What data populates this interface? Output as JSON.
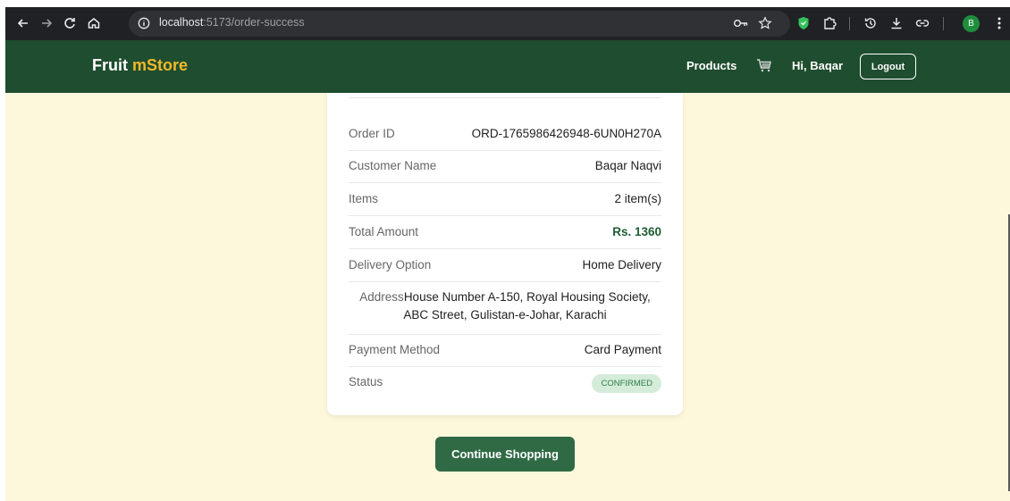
{
  "browser": {
    "url_host": "localhost",
    "url_path": ":5173/order-success",
    "profile_initial": "B"
  },
  "header": {
    "brand_part1": "Fruit ",
    "brand_part2": "mStore",
    "nav_products": "Products",
    "greeting": "Hi, Baqar",
    "logout_label": "Logout"
  },
  "order": {
    "rows": [
      {
        "label": "Order ID",
        "value": "ORD-1765986426948-6UN0H270A"
      },
      {
        "label": "Customer Name",
        "value": "Baqar Naqvi"
      },
      {
        "label": "Items",
        "value": "2 item(s)"
      },
      {
        "label": "Total Amount",
        "value": "Rs. 1360"
      },
      {
        "label": "Delivery Option",
        "value": "Home Delivery"
      }
    ],
    "address_label": "Address",
    "address_line1": "House Number A-150, Royal Housing Society,",
    "address_line2": "ABC Street, Gulistan-e-Johar, Karachi",
    "payment_label": "Payment Method",
    "payment_value": "Card Payment",
    "status_label": "Status",
    "status_value": "CONFIRMED"
  },
  "cta_label": "Continue Shopping",
  "colors": {
    "header_bg": "#1f4d2f",
    "brand_accent": "#f2b92b",
    "page_bg": "#fdf7dc",
    "button_bg": "#2f6a45",
    "amount_color": "#1f5c36",
    "badge_bg": "#d4ecd9"
  },
  "icons": [
    "back-arrow-icon",
    "forward-arrow-icon",
    "reload-icon",
    "home-icon",
    "info-icon",
    "key-icon",
    "star-icon",
    "shield-extension-icon",
    "puzzle-icon",
    "history-icon",
    "download-icon",
    "link-icon",
    "kebab-menu-icon",
    "cart-icon"
  ]
}
